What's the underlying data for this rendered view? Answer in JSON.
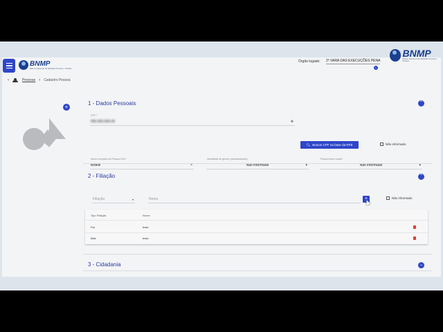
{
  "header": {
    "orgao_label": "Órgão logado:",
    "orgao_value": "2ª VARA DAS EXECUÇÕES PENA",
    "logo_text": "BNMP",
    "logo_sub": "Banco Nacional de Medidas Penais e Prisões",
    "info_icon": "info-icon",
    "menu_icon": "hamburger-icon"
  },
  "breadcrumb": {
    "back_icon": "chevron-left-icon",
    "section_icon": "people-icon",
    "link": "Pessoas",
    "separator": "›",
    "current": "Cadastro Pessoa"
  },
  "photo": {
    "add_label": "+"
  },
  "section1": {
    "title": "1 - Dados Pessoais",
    "collapse_icon": "chevron-up-icon",
    "cpf": {
      "label": "CPF *",
      "value": "000.000.000-00",
      "clear": "⊗"
    },
    "btn_cpf": "Buscar CPF na base da RFB",
    "nao_informado": "Não informado",
    "nome": {
      "label": "Nome completo do Pessoa Civil *",
      "value": "testeiii",
      "clear": "×"
    },
    "genero": {
      "label": "Identidade de gênero (autodeclarado)",
      "value": "Não informado",
      "caret": "▾"
    },
    "nome_social": {
      "label": "Possui nome social?",
      "value": "Não informado",
      "caret": "▾"
    }
  },
  "section2": {
    "title": "2 - Filiação",
    "collapse_icon": "chevron-up-icon",
    "filiacao_placeholder": "Filiação",
    "nome_placeholder": "Nome",
    "add_label": "+",
    "nao_informado": "Não informado",
    "table": {
      "headers": [
        "Tipo Filiação",
        "Nome"
      ],
      "rows": [
        {
          "tipo": "Pai",
          "nome": "teste"
        },
        {
          "tipo": "Mãe",
          "nome": "teste"
        }
      ]
    }
  },
  "section3": {
    "title": "3 - Cidadania",
    "collapse_icon": "chevron-down-icon"
  },
  "colors": {
    "primary": "#2e46c9",
    "title": "#2b3aa0",
    "danger": "#d9413a"
  }
}
